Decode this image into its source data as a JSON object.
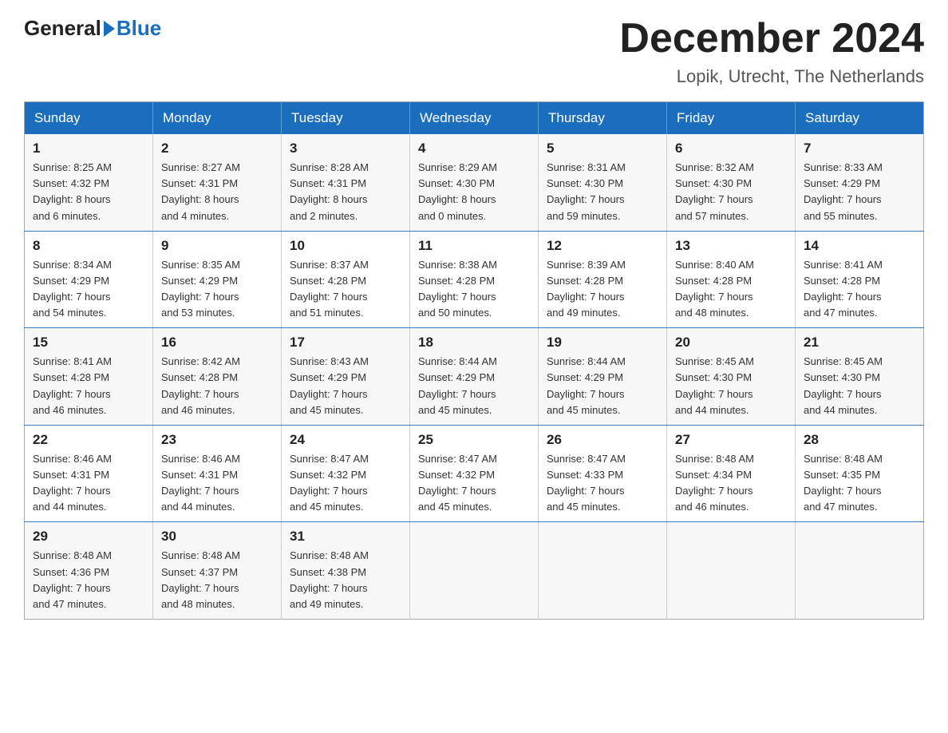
{
  "header": {
    "logo_general": "General",
    "logo_blue": "Blue",
    "month_title": "December 2024",
    "location": "Lopik, Utrecht, The Netherlands"
  },
  "days_of_week": [
    "Sunday",
    "Monday",
    "Tuesday",
    "Wednesday",
    "Thursday",
    "Friday",
    "Saturday"
  ],
  "weeks": [
    [
      {
        "day": "1",
        "sunrise": "8:25 AM",
        "sunset": "4:32 PM",
        "daylight_hours": "8",
        "daylight_minutes": "6"
      },
      {
        "day": "2",
        "sunrise": "8:27 AM",
        "sunset": "4:31 PM",
        "daylight_hours": "8",
        "daylight_minutes": "4"
      },
      {
        "day": "3",
        "sunrise": "8:28 AM",
        "sunset": "4:31 PM",
        "daylight_hours": "8",
        "daylight_minutes": "2"
      },
      {
        "day": "4",
        "sunrise": "8:29 AM",
        "sunset": "4:30 PM",
        "daylight_hours": "8",
        "daylight_minutes": "0"
      },
      {
        "day": "5",
        "sunrise": "8:31 AM",
        "sunset": "4:30 PM",
        "daylight_hours": "7",
        "daylight_minutes": "59"
      },
      {
        "day": "6",
        "sunrise": "8:32 AM",
        "sunset": "4:30 PM",
        "daylight_hours": "7",
        "daylight_minutes": "57"
      },
      {
        "day": "7",
        "sunrise": "8:33 AM",
        "sunset": "4:29 PM",
        "daylight_hours": "7",
        "daylight_minutes": "55"
      }
    ],
    [
      {
        "day": "8",
        "sunrise": "8:34 AM",
        "sunset": "4:29 PM",
        "daylight_hours": "7",
        "daylight_minutes": "54"
      },
      {
        "day": "9",
        "sunrise": "8:35 AM",
        "sunset": "4:29 PM",
        "daylight_hours": "7",
        "daylight_minutes": "53"
      },
      {
        "day": "10",
        "sunrise": "8:37 AM",
        "sunset": "4:28 PM",
        "daylight_hours": "7",
        "daylight_minutes": "51"
      },
      {
        "day": "11",
        "sunrise": "8:38 AM",
        "sunset": "4:28 PM",
        "daylight_hours": "7",
        "daylight_minutes": "50"
      },
      {
        "day": "12",
        "sunrise": "8:39 AM",
        "sunset": "4:28 PM",
        "daylight_hours": "7",
        "daylight_minutes": "49"
      },
      {
        "day": "13",
        "sunrise": "8:40 AM",
        "sunset": "4:28 PM",
        "daylight_hours": "7",
        "daylight_minutes": "48"
      },
      {
        "day": "14",
        "sunrise": "8:41 AM",
        "sunset": "4:28 PM",
        "daylight_hours": "7",
        "daylight_minutes": "47"
      }
    ],
    [
      {
        "day": "15",
        "sunrise": "8:41 AM",
        "sunset": "4:28 PM",
        "daylight_hours": "7",
        "daylight_minutes": "46"
      },
      {
        "day": "16",
        "sunrise": "8:42 AM",
        "sunset": "4:28 PM",
        "daylight_hours": "7",
        "daylight_minutes": "46"
      },
      {
        "day": "17",
        "sunrise": "8:43 AM",
        "sunset": "4:29 PM",
        "daylight_hours": "7",
        "daylight_minutes": "45"
      },
      {
        "day": "18",
        "sunrise": "8:44 AM",
        "sunset": "4:29 PM",
        "daylight_hours": "7",
        "daylight_minutes": "45"
      },
      {
        "day": "19",
        "sunrise": "8:44 AM",
        "sunset": "4:29 PM",
        "daylight_hours": "7",
        "daylight_minutes": "45"
      },
      {
        "day": "20",
        "sunrise": "8:45 AM",
        "sunset": "4:30 PM",
        "daylight_hours": "7",
        "daylight_minutes": "44"
      },
      {
        "day": "21",
        "sunrise": "8:45 AM",
        "sunset": "4:30 PM",
        "daylight_hours": "7",
        "daylight_minutes": "44"
      }
    ],
    [
      {
        "day": "22",
        "sunrise": "8:46 AM",
        "sunset": "4:31 PM",
        "daylight_hours": "7",
        "daylight_minutes": "44"
      },
      {
        "day": "23",
        "sunrise": "8:46 AM",
        "sunset": "4:31 PM",
        "daylight_hours": "7",
        "daylight_minutes": "44"
      },
      {
        "day": "24",
        "sunrise": "8:47 AM",
        "sunset": "4:32 PM",
        "daylight_hours": "7",
        "daylight_minutes": "45"
      },
      {
        "day": "25",
        "sunrise": "8:47 AM",
        "sunset": "4:32 PM",
        "daylight_hours": "7",
        "daylight_minutes": "45"
      },
      {
        "day": "26",
        "sunrise": "8:47 AM",
        "sunset": "4:33 PM",
        "daylight_hours": "7",
        "daylight_minutes": "45"
      },
      {
        "day": "27",
        "sunrise": "8:48 AM",
        "sunset": "4:34 PM",
        "daylight_hours": "7",
        "daylight_minutes": "46"
      },
      {
        "day": "28",
        "sunrise": "8:48 AM",
        "sunset": "4:35 PM",
        "daylight_hours": "7",
        "daylight_minutes": "47"
      }
    ],
    [
      {
        "day": "29",
        "sunrise": "8:48 AM",
        "sunset": "4:36 PM",
        "daylight_hours": "7",
        "daylight_minutes": "47"
      },
      {
        "day": "30",
        "sunrise": "8:48 AM",
        "sunset": "4:37 PM",
        "daylight_hours": "7",
        "daylight_minutes": "48"
      },
      {
        "day": "31",
        "sunrise": "8:48 AM",
        "sunset": "4:38 PM",
        "daylight_hours": "7",
        "daylight_minutes": "49"
      },
      null,
      null,
      null,
      null
    ]
  ]
}
